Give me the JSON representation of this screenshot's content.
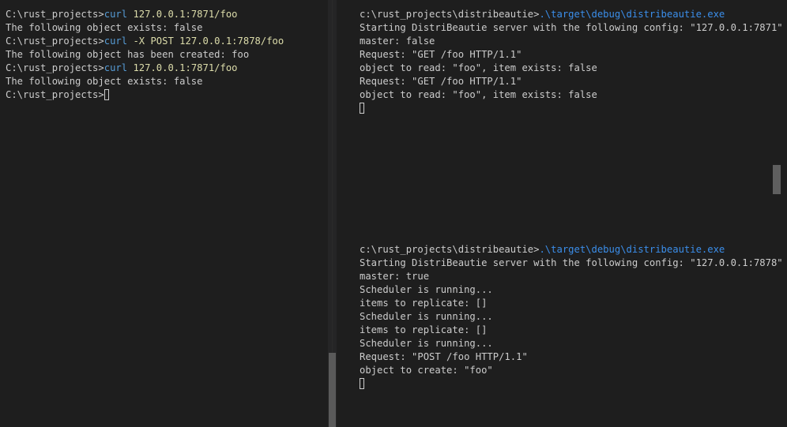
{
  "left_terminal": {
    "lines": [
      {
        "prompt": "C:\\rust_projects>",
        "cmd": "curl",
        "flags": "",
        "args": " 127.0.0.1:7871/foo"
      },
      {
        "text": "The following object exists: false"
      },
      {
        "prompt": "C:\\rust_projects>",
        "cmd": "curl",
        "flags": " -X POST",
        "args": " 127.0.0.1:7878/foo"
      },
      {
        "text": "The following object has been created: foo"
      },
      {
        "prompt": "C:\\rust_projects>",
        "cmd": "curl",
        "flags": "",
        "args": " 127.0.0.1:7871/foo"
      },
      {
        "text": "The following object exists: false"
      },
      {
        "prompt": "C:\\rust_projects>"
      }
    ]
  },
  "right_top_terminal": {
    "prompt": "c:\\rust_projects\\distribeautie>",
    "command": ".\\target\\debug\\distribeautie.exe",
    "output": [
      "Starting DistriBeautie server with the following config: \"127.0.0.1:7871\"",
      "master: false",
      "Request: \"GET /foo HTTP/1.1\"",
      "object to read: \"foo\", item exists: false",
      "Request: \"GET /foo HTTP/1.1\"",
      "object to read: \"foo\", item exists: false"
    ]
  },
  "right_bottom_terminal": {
    "prompt": "c:\\rust_projects\\distribeautie>",
    "command": ".\\target\\debug\\distribeautie.exe",
    "output": [
      "Starting DistriBeautie server with the following config: \"127.0.0.1:7878\"",
      "master: true",
      "Scheduler is running...",
      "items to replicate: []",
      "Scheduler is running...",
      "items to replicate: []",
      "Scheduler is running...",
      "Request: \"POST /foo HTTP/1.1\"",
      "object to create: \"foo\""
    ]
  }
}
